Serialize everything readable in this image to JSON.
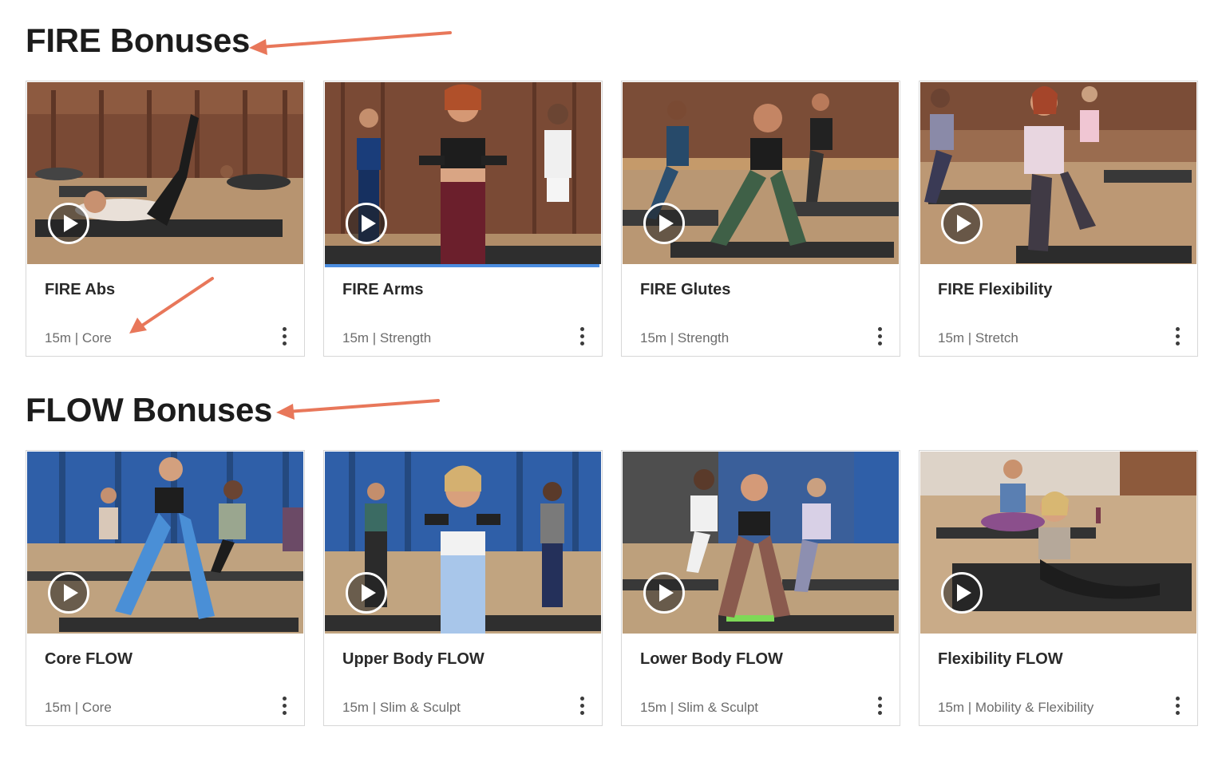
{
  "sections": [
    {
      "title": "FIRE Bonuses",
      "cards": [
        {
          "title": "FIRE Abs",
          "meta": "15m | Core"
        },
        {
          "title": "FIRE Arms",
          "meta": "15m | Strength",
          "progress": 1.0
        },
        {
          "title": "FIRE Glutes",
          "meta": "15m | Strength"
        },
        {
          "title": "FIRE Flexibility",
          "meta": "15m | Stretch"
        }
      ]
    },
    {
      "title": "FLOW Bonuses",
      "cards": [
        {
          "title": "Core FLOW",
          "meta": "15m | Core"
        },
        {
          "title": "Upper Body FLOW",
          "meta": "15m | Slim & Sculpt"
        },
        {
          "title": "Lower Body FLOW",
          "meta": "15m | Slim & Sculpt"
        },
        {
          "title": "Flexibility FLOW",
          "meta": "15m | Mobility & Flexibility"
        }
      ]
    }
  ],
  "colors": {
    "annotation_arrow": "#e8775a",
    "progress_bar": "#4b8de0",
    "fire_backdrop": "#7a4a35",
    "flow_backdrop": "#2f5fa8",
    "floor": "#b79470"
  },
  "icons": {
    "play": "play-icon",
    "more": "more-options-icon",
    "arrow": "annotation-arrow-icon"
  }
}
